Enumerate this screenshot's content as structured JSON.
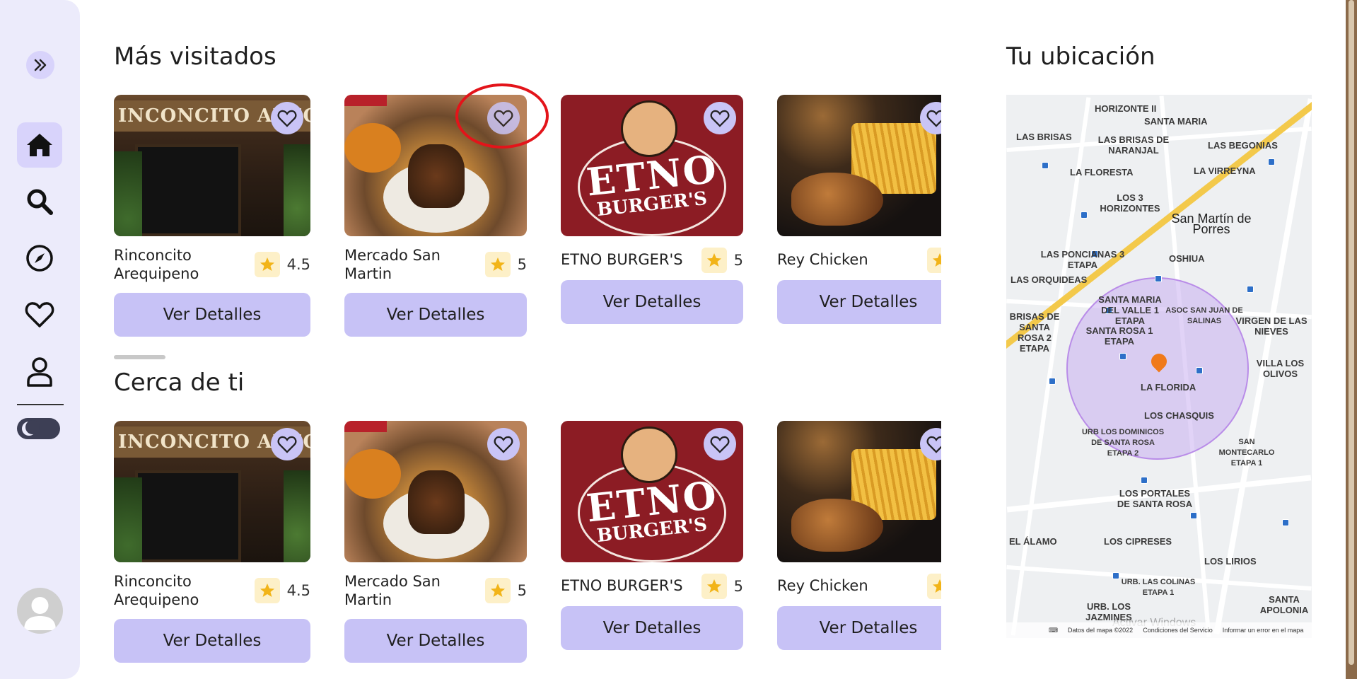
{
  "sections": {
    "most_visited": "Más visitados",
    "nearby": "Cerca de ti",
    "location": "Tu ubicación"
  },
  "buttons": {
    "details_label": "Ver Detalles"
  },
  "restaurants": [
    {
      "name": "Rinconcito Arequipeno",
      "rating": "4.5",
      "sign": "INCONCITO AREQU"
    },
    {
      "name": "Mercado San Martin",
      "rating": "5"
    },
    {
      "name": "ETNO BURGER'S",
      "rating": "5",
      "brand_top": "ETNO",
      "brand_bottom": "BURGER'S"
    },
    {
      "name": "Rey Chicken",
      "rating": ""
    }
  ],
  "map": {
    "labels": [
      "HORIZONTE II",
      "SANTA MARIA",
      "LAS BRISAS",
      "LAS BRISAS DE NARANJAL",
      "LAS BEGONIAS",
      "LA FLORESTA",
      "LA VIRREYNA",
      "LOS 3 HORIZONTES",
      "San Martín de Porres",
      "LAS PONCIANAS 3 ETAPA",
      "OSHIUA",
      "LAS ORQUIDEAS",
      "SANTA MARIA DEL VALLE 1 ETAPA",
      "SANTA ROSA 1 ETAPA",
      "ASOC SAN JUAN DE SALINAS",
      "VIRGEN DE LAS NIEVES",
      "BRISAS DE SANTA ROSA 2 ETAPA",
      "LA FLORIDA",
      "VILLA LOS OLIVOS",
      "LOS CHASQUIS",
      "URB LOS DOMINICOS DE SANTA ROSA ETAPA 2",
      "SAN MONTECARLO ETAPA 1",
      "LOS PORTALES DE SANTA ROSA",
      "EL ÁLAMO",
      "LOS CIPRESES",
      "LOS LIRIOS",
      "URB. LAS COLINAS ETAPA 1",
      "URB. LOS JAZMINES",
      "SANTA APOLONIA"
    ],
    "footer": [
      "Datos del mapa ©2022",
      "Condiciones del Servicio",
      "Informar un error en el mapa"
    ],
    "watermark": "Activar Windows"
  }
}
